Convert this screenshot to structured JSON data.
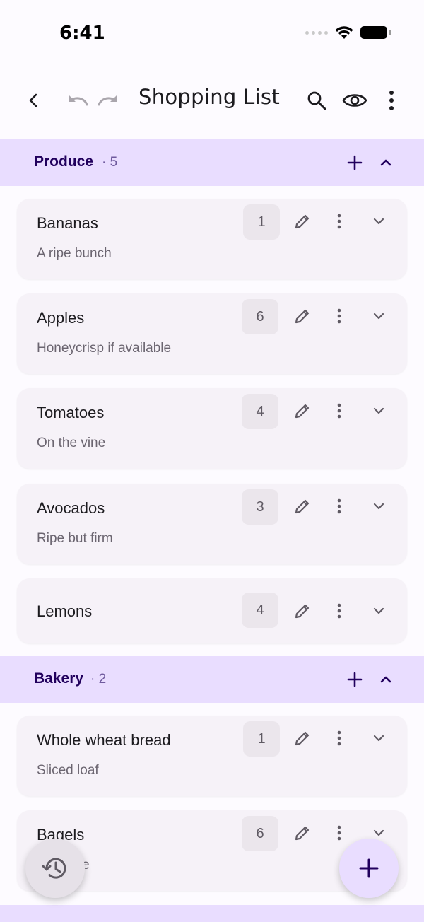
{
  "status": {
    "time": "6:41"
  },
  "appbar": {
    "title": "Shopping List"
  },
  "sections": [
    {
      "name": "Produce",
      "count": "· 5",
      "items": [
        {
          "title": "Bananas",
          "note": "A ripe bunch",
          "qty": "1"
        },
        {
          "title": "Apples",
          "note": "Honeycrisp if available",
          "qty": "6"
        },
        {
          "title": "Tomatoes",
          "note": "On the vine",
          "qty": "4"
        },
        {
          "title": "Avocados",
          "note": "Ripe but firm",
          "qty": "3"
        },
        {
          "title": "Lemons",
          "note": "",
          "qty": "4"
        }
      ]
    },
    {
      "name": "Bakery",
      "count": "· 2",
      "items": [
        {
          "title": "Whole wheat bread",
          "note": "Sliced loaf",
          "qty": "1"
        },
        {
          "title": "Bagels",
          "note": "e",
          "qty": "6"
        }
      ]
    }
  ],
  "icons": {
    "back": "arrow-back-icon",
    "undo": "undo-icon",
    "redo": "redo-icon",
    "search": "search-icon",
    "visibility": "eye-icon",
    "more": "more-vert-icon",
    "add": "plus-icon",
    "collapse": "chevron-up-icon",
    "expand": "chevron-down-icon",
    "edit": "pencil-icon",
    "history": "history-icon"
  },
  "colors": {
    "section_bg": "#e9ddff",
    "section_text": "#21005d",
    "card_bg": "#f6f2f8",
    "fab_bg": "#e9ddff"
  }
}
